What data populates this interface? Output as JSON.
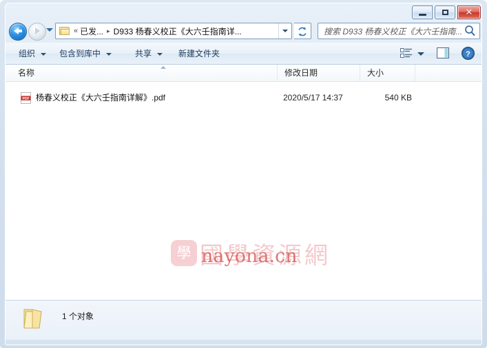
{
  "window": {
    "buttons": {
      "minimize": "minimize-button",
      "maximize": "maximize-button",
      "close_glyph": "✕"
    }
  },
  "navigation": {
    "back_tooltip": "后退",
    "forward_tooltip": "前进",
    "refresh_tooltip": "刷新",
    "breadcrumb": {
      "overflow_chevron": "«",
      "parent": "已发...",
      "separator": "▸",
      "current": "D933 杨春义校正《大六壬指南详..."
    }
  },
  "search": {
    "placeholder": "搜索 D933 杨春义校正《大六壬指南..."
  },
  "toolbar": {
    "organize": "组织",
    "include_in_library": "包含到库中",
    "share": "共享",
    "new_folder": "新建文件夹",
    "view_icon": "view-options-icon",
    "preview_icon": "preview-pane-icon",
    "help_icon": "help-icon"
  },
  "columns": {
    "name": "名称",
    "date_modified": "修改日期",
    "size": "大小",
    "blank": ""
  },
  "files": [
    {
      "icon": "pdf-file-icon",
      "name": "杨春义校正《大六壬指南详解》.pdf",
      "date_modified": "2020/5/17 14:37",
      "size": "540 KB"
    }
  ],
  "watermark": {
    "badge_glyph": "學",
    "chinese": "國學資源網",
    "latin": "nayona.cn",
    "color_chinese": "#f4c9cd",
    "color_latin": "#d4534f"
  },
  "statusbar": {
    "icon": "folder-icon",
    "text": "1 个对象"
  },
  "colors": {
    "frame": "#d3e0ee",
    "accent": "#2a93e8",
    "close_button": "#c8392c",
    "pane_background": "#ffffff"
  }
}
